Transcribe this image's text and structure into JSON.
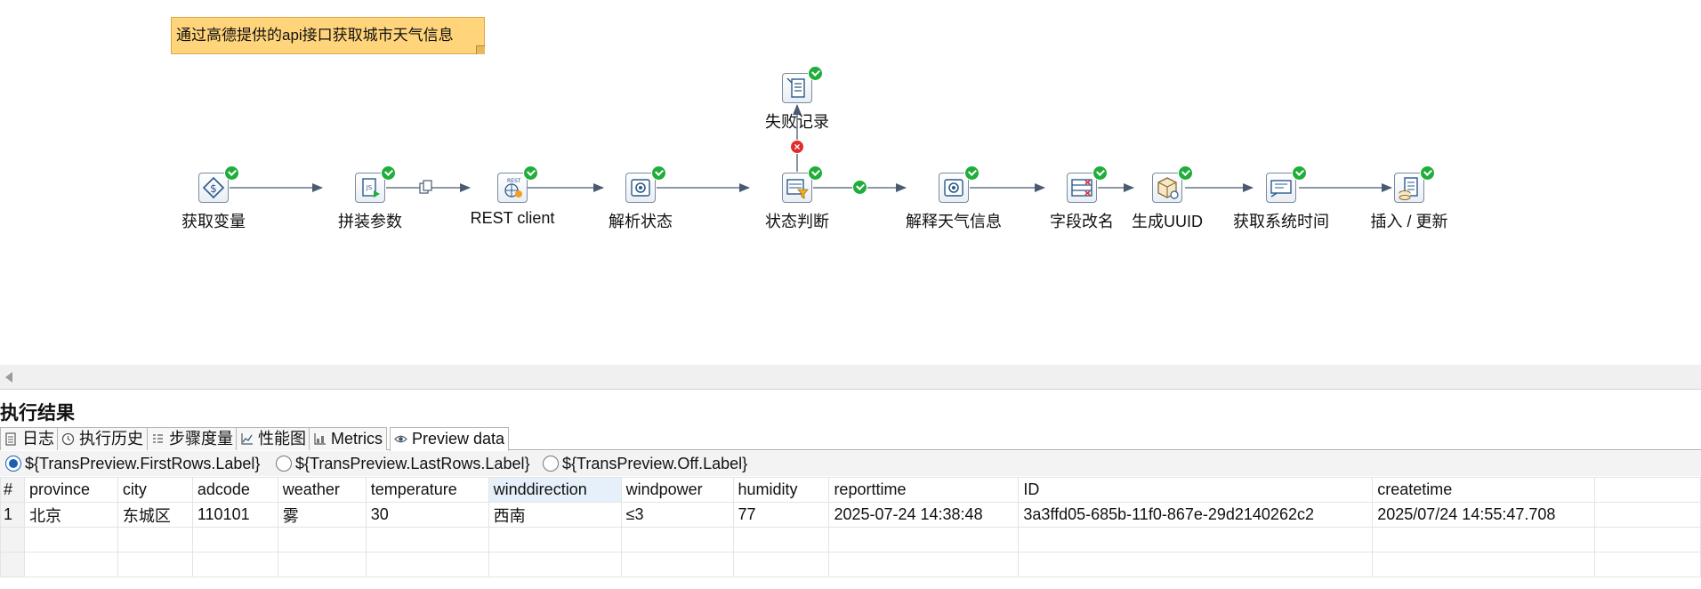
{
  "canvas": {
    "note": "通过高德提供的api接口获取城市天气信息",
    "steps": [
      {
        "id": "get-variables",
        "label": "获取变量",
        "icon": "variable-icon"
      },
      {
        "id": "build-params",
        "label": "拼装参数",
        "icon": "script-icon"
      },
      {
        "id": "rest-client",
        "label": "REST client",
        "icon": "rest-icon"
      },
      {
        "id": "parse-status",
        "label": "解析状态",
        "icon": "json-input-icon"
      },
      {
        "id": "status-check",
        "label": "状态判断",
        "icon": "filter-rows-icon"
      },
      {
        "id": "parse-weather",
        "label": "解释天气信息",
        "icon": "json-input-icon"
      },
      {
        "id": "rename-fields",
        "label": "字段改名",
        "icon": "select-values-icon"
      },
      {
        "id": "gen-uuid",
        "label": "生成UUID",
        "icon": "uuid-icon"
      },
      {
        "id": "get-system-time",
        "label": "获取系统时间",
        "icon": "system-info-icon"
      },
      {
        "id": "insert-update",
        "label": "插入 / 更新",
        "icon": "insert-update-icon"
      },
      {
        "id": "fail-record",
        "label": "失败记录",
        "icon": "text-output-icon"
      }
    ]
  },
  "results": {
    "title": "执行结果",
    "tabs": [
      {
        "label": "日志",
        "icon": "log-icon",
        "active": false
      },
      {
        "label": "执行历史",
        "icon": "history-icon",
        "active": false
      },
      {
        "label": "步骤度量",
        "icon": "step-metrics-icon",
        "active": false
      },
      {
        "label": "性能图",
        "icon": "performance-icon",
        "active": false
      },
      {
        "label": "Metrics",
        "icon": "metrics-icon",
        "active": false
      },
      {
        "label": "Preview data",
        "icon": "eye-icon",
        "active": true
      }
    ],
    "radios": [
      {
        "label": "${TransPreview.FirstRows.Label}",
        "selected": true
      },
      {
        "label": "${TransPreview.LastRows.Label}",
        "selected": false
      },
      {
        "label": "${TransPreview.Off.Label}",
        "selected": false
      }
    ],
    "table": {
      "columns": [
        "#",
        "province",
        "city",
        "adcode",
        "weather",
        "temperature",
        "winddirection",
        "windpower",
        "humidity",
        "reporttime",
        "ID",
        "createtime"
      ],
      "highlighted_column": "winddirection",
      "rows": [
        [
          "1",
          "北京",
          "东城区",
          "110101",
          "雾",
          "30",
          "西南",
          "≤3",
          "77",
          "2025-07-24 14:38:48",
          "3a3ffd05-685b-11f0-867e-29d2140262c2",
          "2025/07/24 14:55:47.708"
        ]
      ]
    }
  }
}
